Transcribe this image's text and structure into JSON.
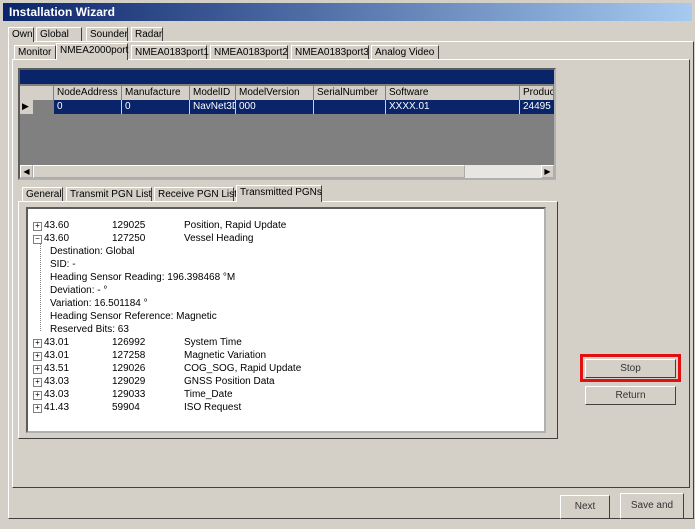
{
  "window": {
    "title": "Installation Wizard"
  },
  "top_tabs": [
    {
      "label": "Own",
      "selected": true
    },
    {
      "label": "Global",
      "selected": false
    },
    {
      "label": "Sounder",
      "selected": false
    },
    {
      "label": "Radar",
      "selected": false
    }
  ],
  "sub_tabs": [
    {
      "label": "Monitor",
      "selected": false
    },
    {
      "label": "NMEA2000port",
      "selected": true
    },
    {
      "label": "NMEA0183port1",
      "selected": false
    },
    {
      "label": "NMEA0183port2",
      "selected": false
    },
    {
      "label": "NMEA0183port3",
      "selected": false
    },
    {
      "label": "Analog Video",
      "selected": false
    }
  ],
  "device_table": {
    "columns": [
      "NodeAddress",
      "Manufacture",
      "ModelID",
      "ModelVersion",
      "SerialNumber",
      "Software",
      "Product"
    ],
    "rows": [
      [
        "0",
        "0",
        "NavNet3D",
        "000",
        "",
        "XXXX.01",
        "24495"
      ]
    ]
  },
  "pgn_tabs": [
    {
      "label": "General",
      "selected": false
    },
    {
      "label": "Transmit PGN List",
      "selected": false
    },
    {
      "label": "Receive PGN List",
      "selected": false
    },
    {
      "label": "Transmitted PGNs",
      "selected": true
    }
  ],
  "pgn_tree": {
    "items": [
      {
        "source": "43.60",
        "pgn": "129025",
        "name": "Position, Rapid Update",
        "expanded": false
      },
      {
        "source": "43.60",
        "pgn": "127250",
        "name": "Vessel Heading",
        "expanded": true
      },
      {
        "source": "43.01",
        "pgn": "126992",
        "name": "System Time",
        "expanded": false
      },
      {
        "source": "43.01",
        "pgn": "127258",
        "name": "Magnetic Variation",
        "expanded": false
      },
      {
        "source": "43.51",
        "pgn": "129026",
        "name": "COG_SOG, Rapid Update",
        "expanded": false
      },
      {
        "source": "43.03",
        "pgn": "129029",
        "name": "GNSS Position Data",
        "expanded": false
      },
      {
        "source": "43.03",
        "pgn": "129033",
        "name": "Time_Date",
        "expanded": false
      },
      {
        "source": "41.43",
        "pgn": "59904",
        "name": "ISO Request",
        "expanded": false
      }
    ],
    "details": [
      "Destination: Global",
      "SID: -",
      "Heading Sensor Reading: 196.398468 °M",
      "Deviation: - °",
      "Variation: 16.501184 °",
      "Heading Sensor Reference: Magnetic",
      "Reserved Bits: 63"
    ]
  },
  "buttons": {
    "stop": "Stop",
    "return": "Return",
    "next": "Next",
    "save_and": "Save and"
  },
  "colors": {
    "highlight": "#0a246a",
    "accent_red": "#e01010"
  }
}
